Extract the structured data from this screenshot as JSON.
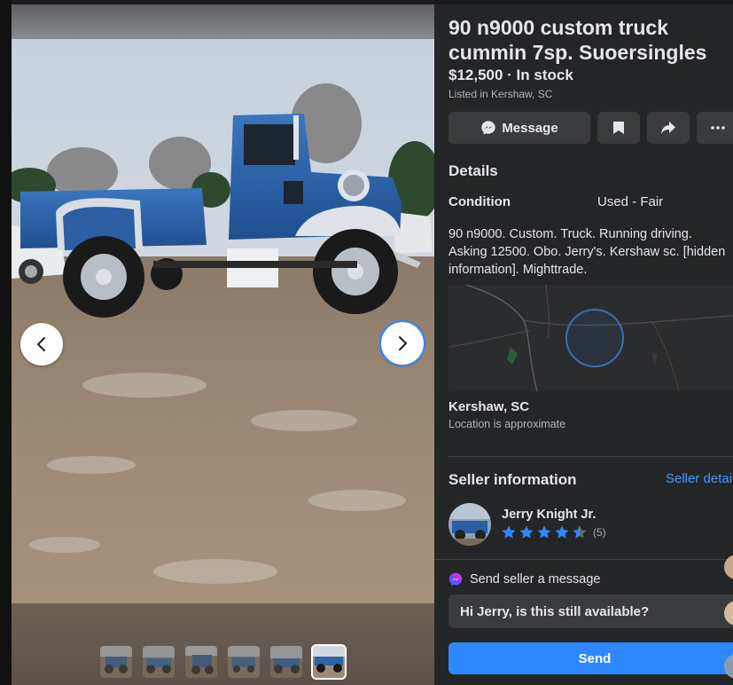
{
  "listing": {
    "title": "90 n9000 custom truck cummin 7sp. Suoersingles",
    "price_status": "$12,500 · In stock",
    "listed_in": "Listed in Kershaw, SC"
  },
  "actions": {
    "message_label": "Message"
  },
  "details": {
    "heading": "Details",
    "condition_label": "Condition",
    "condition_value": "Used - Fair",
    "description_lines": [
      "90 n9000.  Custom. Truck. Running driving.",
      "Asking 12500.  Obo.  Jerry's.  Kershaw sc. [hidden",
      "information]. Mighttrade."
    ]
  },
  "location": {
    "name": "Kershaw, SC",
    "note": "Location is approximate"
  },
  "seller": {
    "heading": "Seller information",
    "details_link": "Seller details",
    "name": "Jerry Knight Jr.",
    "rating": 4.5,
    "rating_count": "(5)"
  },
  "messaging": {
    "heading": "Send seller a message",
    "input_value": "Hi Jerry, is this still available?",
    "send_label": "Send"
  },
  "gallery": {
    "thumbnail_count": 6,
    "active_index": 5
  },
  "colors": {
    "accent": "#2d88ff",
    "link": "#4599ff",
    "panel_bg": "#242526",
    "button_bg": "#3a3b3c",
    "star": "#2d88ff"
  }
}
